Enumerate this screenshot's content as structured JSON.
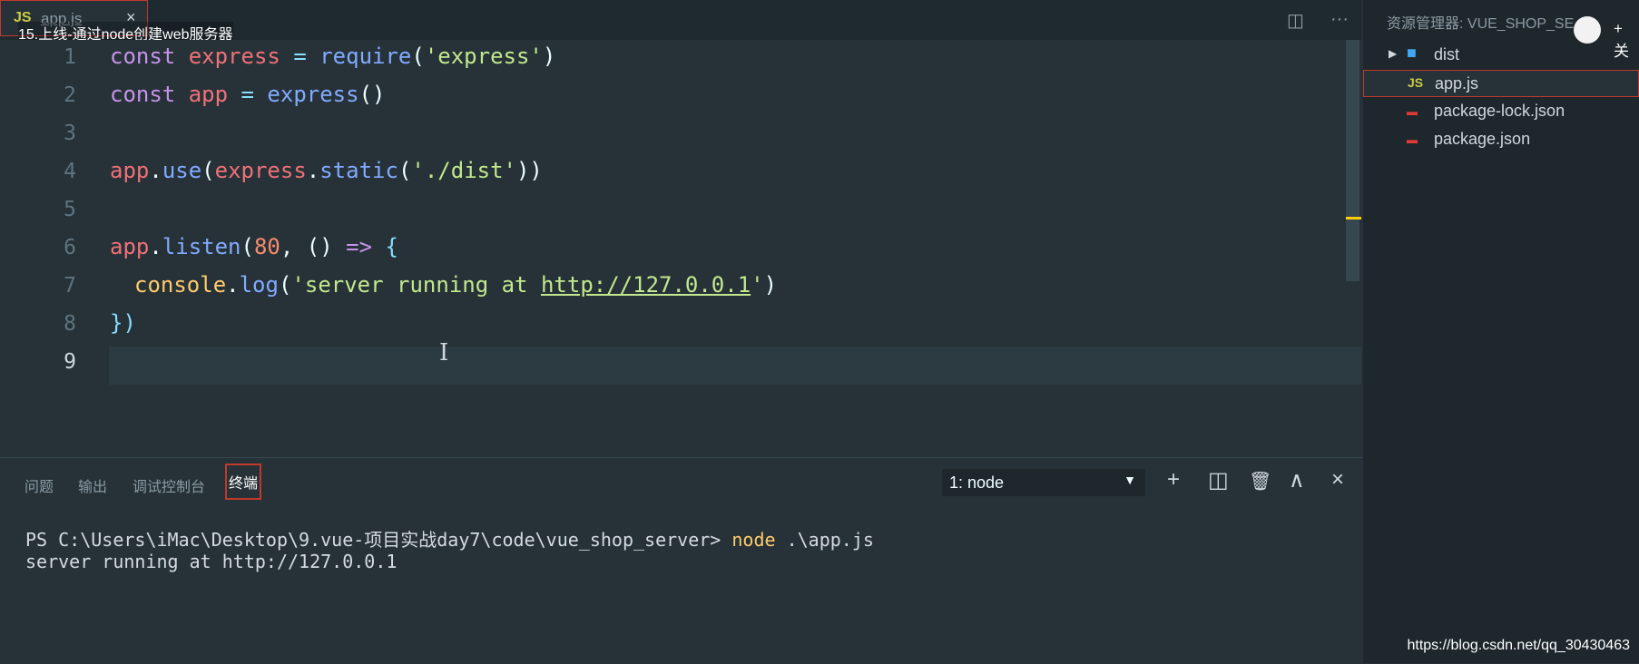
{
  "tab": {
    "badge": "JS",
    "filename": "app.js",
    "close": "×"
  },
  "video_title": "15.上线-通过node创建web服务器",
  "editor_actions": {
    "split": "◫",
    "more": "···"
  },
  "code_lines": {
    "numbers": [
      "1",
      "2",
      "3",
      "4",
      "5",
      "6",
      "7",
      "8",
      "9"
    ],
    "l1": [
      "const",
      "express",
      "=",
      "require",
      "(",
      "'express'",
      ")"
    ],
    "l2": [
      "const",
      "app",
      "=",
      "express",
      "()"
    ],
    "l4": [
      "app",
      ".",
      "use",
      "(",
      "express",
      ".",
      "static",
      "(",
      "'./dist'",
      "))"
    ],
    "l6": [
      "app",
      ".",
      "listen",
      "(",
      "80",
      ",",
      "()",
      "=>",
      "{"
    ],
    "l7": [
      "console",
      ".",
      "log",
      "(",
      "'server running at ",
      "http://127.0.0.1",
      "'",
      ")"
    ],
    "l8": [
      "})"
    ]
  },
  "panel": {
    "tabs": [
      "问题",
      "输出",
      "调试控制台",
      "终端"
    ],
    "terminal_select": "1: node",
    "icons": {
      "add": "+",
      "split": "◫",
      "trash": "🗑",
      "maximize": "∧",
      "close": "×"
    },
    "lines": {
      "prompt": "PS C:\\Users\\iMac\\Desktop\\9.vue-项目实战day7\\code\\vue_shop_server> ",
      "cmd": "node",
      "arg": " .\\app.js",
      "output": "server running at http://127.0.0.1"
    }
  },
  "explorer": {
    "title": "资源管理器: VUE_SHOP_SE...",
    "items": [
      {
        "label": "dist",
        "icon": "folder-icon"
      },
      {
        "label": "app.js",
        "icon": "js-file-icon"
      },
      {
        "label": "package-lock.json",
        "icon": "npm-icon"
      },
      {
        "label": "package.json",
        "icon": "npm-icon"
      }
    ],
    "follow_label": "+ 关"
  },
  "watermark": "https://blog.csdn.net/qq_30430463",
  "colors": {
    "editor_bg": "#263238",
    "sidebar_bg": "#1e272c",
    "accent_red": "#c0392b"
  }
}
